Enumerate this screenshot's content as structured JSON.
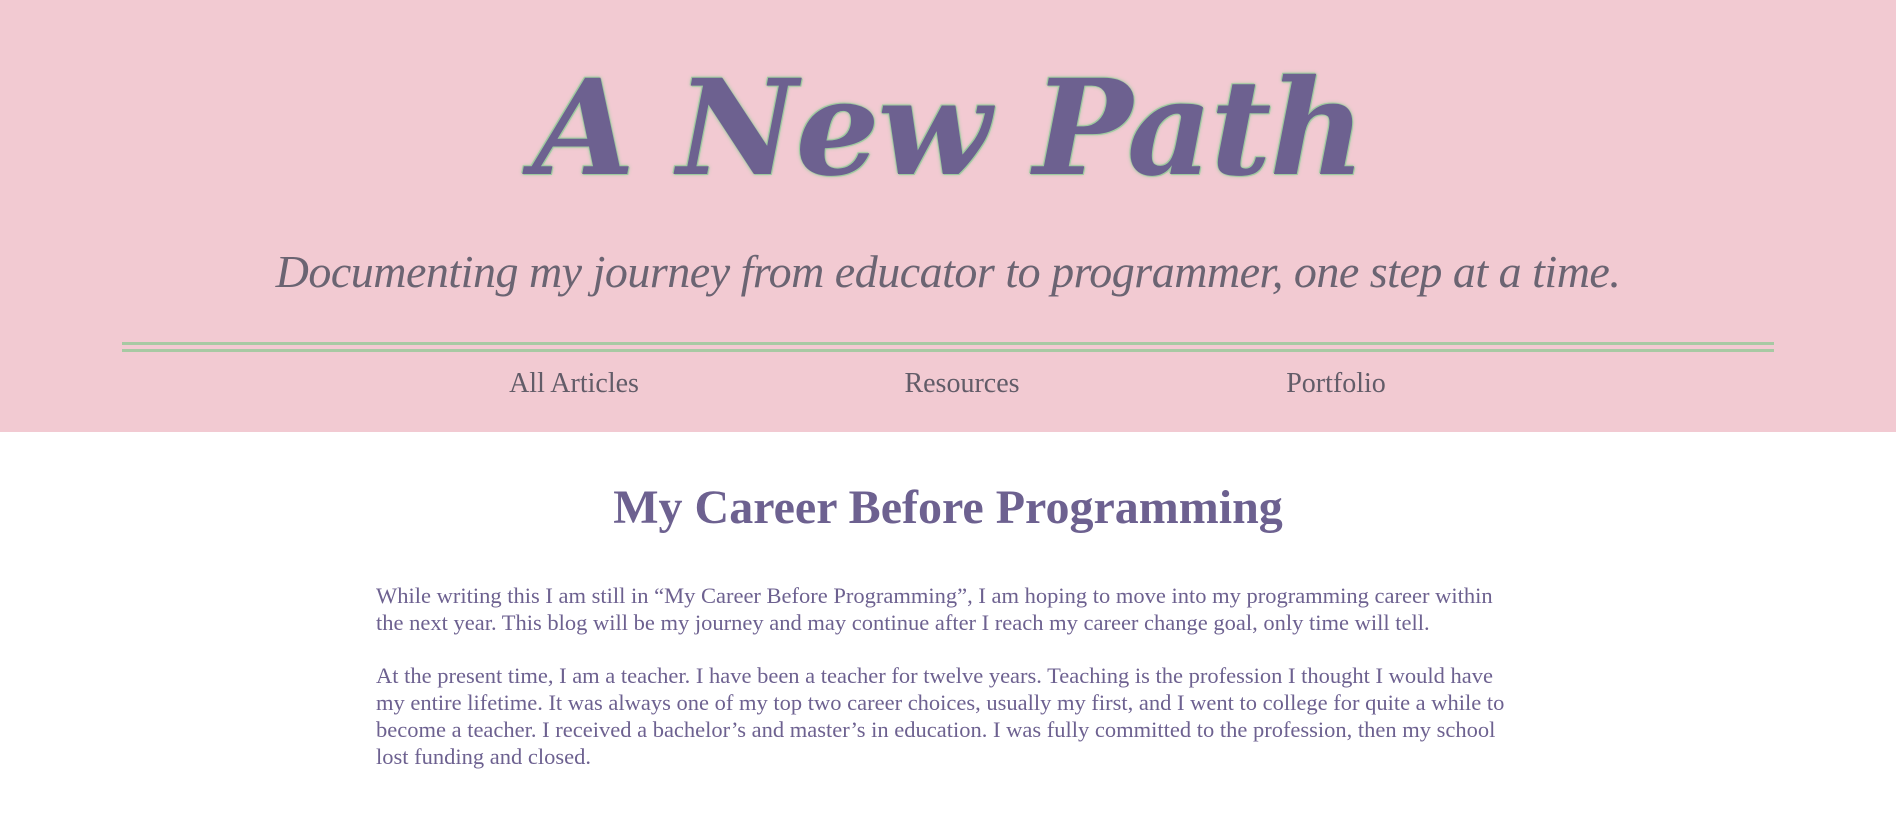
{
  "header": {
    "title": "A New Path",
    "tagline": "Documenting my journey from educator to programmer, one step at a time."
  },
  "nav": {
    "items": [
      {
        "label": "All Articles"
      },
      {
        "label": "Resources"
      },
      {
        "label": "Portfolio"
      }
    ]
  },
  "article": {
    "title": "My Career Before Programming",
    "paragraphs": [
      "While writing this I am still in “My Career Before Programming”, I am hoping to move into my programming career within the next year. This blog will be my journey and may continue after I reach my career change goal, only time will tell.",
      "At the present time, I am a teacher. I have been a teacher for twelve years. Teaching is the profession I thought I would have my entire lifetime. It was always one of my top two career choices, usually my first, and I went to college for quite a while to become a teacher. I received a bachelor’s and master’s in education. I was fully committed to the profession, then my school lost funding and closed."
    ]
  },
  "colors": {
    "header_background": "#f2cad2",
    "title_color": "#6d6190",
    "title_outline": "#9fcaa0",
    "divider": "#a7c9a3",
    "nav_text": "#625c68",
    "body_text": "#6d6190",
    "page_background": "#ffffff"
  }
}
